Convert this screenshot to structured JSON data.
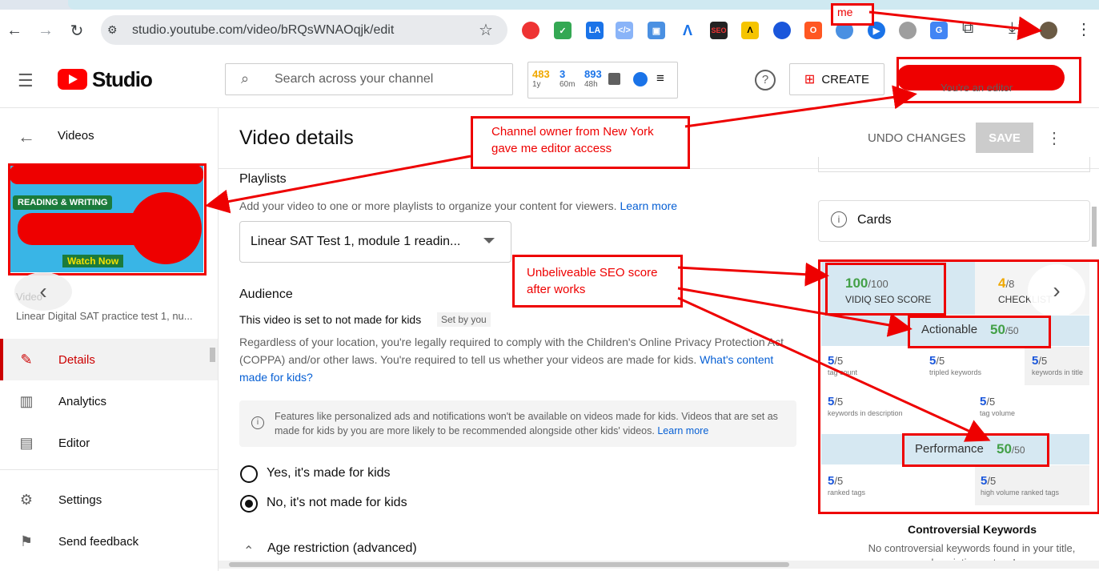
{
  "browser": {
    "url": "studio.youtube.com/video/bRQsWNAOqjk/edit"
  },
  "header": {
    "logo_text": "Studio",
    "search_placeholder": "Search across your channel",
    "stats": [
      {
        "value": "483",
        "sub": "1y",
        "color": "#f0a800"
      },
      {
        "value": "3",
        "sub": "60m",
        "color": "#1a73e8"
      },
      {
        "value": "893",
        "sub": "48h",
        "color": "#1a73e8"
      }
    ],
    "create_label": "CREATE",
    "account_role": "You're an editor"
  },
  "sidebar": {
    "back_label": "Videos",
    "thumb_badge_1": "READING & WRITING",
    "thumb_watch": "Watch Now",
    "video_label": "Video",
    "video_title": "Linear Digital SAT practice test 1, nu...",
    "items": [
      {
        "label": "Details",
        "icon": "pencil-icon",
        "active": true
      },
      {
        "label": "Analytics",
        "icon": "analytics-icon",
        "active": false
      },
      {
        "label": "Editor",
        "icon": "editor-icon",
        "active": false
      },
      {
        "label": "Settings",
        "icon": "gear-icon",
        "active": false
      },
      {
        "label": "Send feedback",
        "icon": "feedback-icon",
        "active": false
      }
    ]
  },
  "main": {
    "title": "Video details",
    "undo_label": "UNDO CHANGES",
    "save_label": "SAVE",
    "playlists_title": "Playlists",
    "playlists_desc": "Add your video to one or more playlists to organize your content for viewers.",
    "learn_more": "Learn more",
    "playlist_value": "Linear SAT Test 1, module 1 readin...",
    "audience_title": "Audience",
    "audience_status": "This video is set to not made for kids",
    "set_by": "Set by you",
    "coppa_text": "Regardless of your location, you're legally required to comply with the Children's Online Privacy Protection Act (COPPA) and/or other laws. You're required to tell us whether your videos are made for kids.",
    "coppa_link": "What's content made for kids?",
    "info_text": "Features like personalized ads and notifications won't be available on videos made for kids. Videos that are set as made for kids by you are more likely to be recommended alongside other kids' videos.",
    "info_link": "Learn more",
    "radio_yes": "Yes, it's made for kids",
    "radio_no": "No, it's not made for kids",
    "age_restriction": "Age restriction (advanced)"
  },
  "right_panel": {
    "cards_label": "Cards",
    "seo_score": "100",
    "seo_score_max": "/100",
    "seo_label": "VIDIQ SEO SCORE",
    "checklist_score": "4",
    "checklist_max": "/8",
    "checklist_label": "CHECKLIST",
    "actionable_label": "Actionable",
    "actionable_score": "50",
    "actionable_max": "/50",
    "actionable_items": [
      {
        "score": "5",
        "max": "/5",
        "label": "tag count"
      },
      {
        "score": "5",
        "max": "/5",
        "label": "tripled keywords"
      },
      {
        "score": "5",
        "max": "/5",
        "label": "keywords in title"
      },
      {
        "score": "5",
        "max": "/5",
        "label": "keywords in description"
      },
      {
        "score": "5",
        "max": "/5",
        "label": "tag volume"
      }
    ],
    "performance_label": "Performance",
    "performance_score": "50",
    "performance_max": "/50",
    "performance_items": [
      {
        "score": "5",
        "max": "/5",
        "label": "ranked tags"
      },
      {
        "score": "5",
        "max": "/5",
        "label": "high volume ranked tags"
      }
    ],
    "controversial_title": "Controversial Keywords",
    "controversial_text": "No controversial keywords found in your title, description or tags!"
  },
  "annotations": {
    "me": "me",
    "owner_line1": "Channel owner from New York",
    "owner_line2": "gave me editor access",
    "seo_line1": "Unbeliveable SEO score",
    "seo_line2": "after works"
  }
}
